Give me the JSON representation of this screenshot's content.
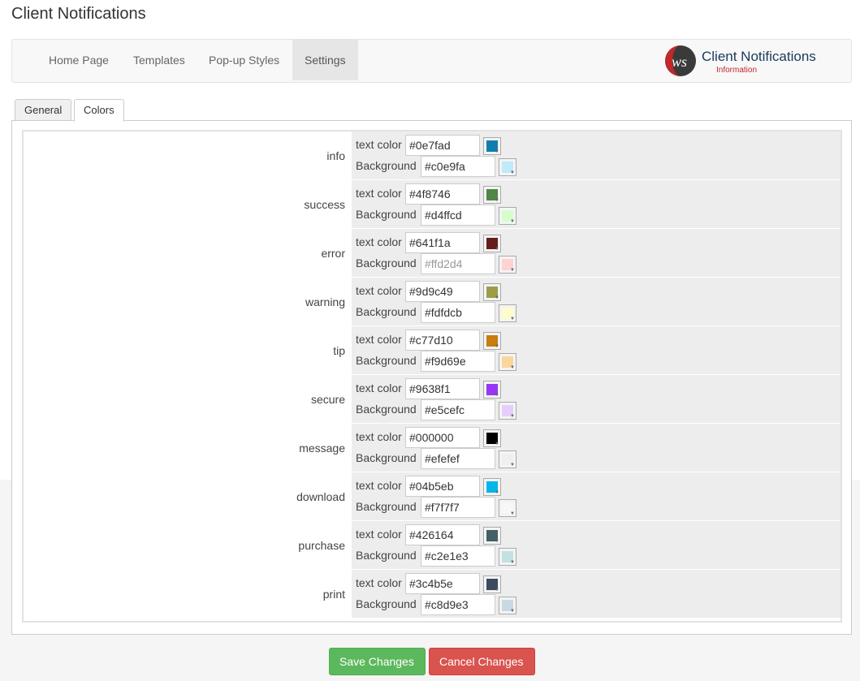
{
  "page": {
    "title": "Client Notifications"
  },
  "nav": {
    "items": [
      {
        "label": "Home Page",
        "active": false
      },
      {
        "label": "Templates",
        "active": false
      },
      {
        "label": "Pop-up Styles",
        "active": false
      },
      {
        "label": "Settings",
        "active": true
      }
    ],
    "brand": {
      "name": "Client Notifications",
      "sub": "Information"
    }
  },
  "tabs": [
    {
      "label": "General",
      "active": false
    },
    {
      "label": "Colors",
      "active": true
    }
  ],
  "fields": {
    "text_label": "text color",
    "bg_label": "Background"
  },
  "colors": [
    {
      "name": "info",
      "text": "#0e7fad",
      "bg": "#c0e9fa"
    },
    {
      "name": "success",
      "text": "#4f8746",
      "bg": "#d4ffcd"
    },
    {
      "name": "error",
      "text": "#641f1a",
      "bg": "#ffd2d4"
    },
    {
      "name": "warning",
      "text": "#9d9c49",
      "bg": "#fdfdcb"
    },
    {
      "name": "tip",
      "text": "#c77d10",
      "bg": "#f9d69e"
    },
    {
      "name": "secure",
      "text": "#9638f1",
      "bg": "#e5cefc"
    },
    {
      "name": "message",
      "text": "#000000",
      "bg": "#efefef"
    },
    {
      "name": "download",
      "text": "#04b5eb",
      "bg": "#f7f7f7"
    },
    {
      "name": "purchase",
      "text": "#426164",
      "bg": "#c2e1e3"
    },
    {
      "name": "print",
      "text": "#3c4b5e",
      "bg": "#c8d9e3"
    }
  ],
  "actions": {
    "save": "Save Changes",
    "cancel": "Cancel Changes"
  }
}
